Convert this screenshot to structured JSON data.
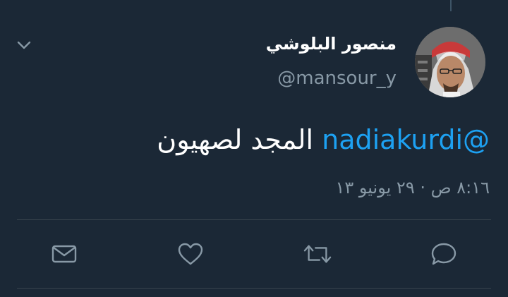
{
  "tweet": {
    "display_name": "منصور البلوشي",
    "handle": "@mansour_y",
    "mention": "@nadiakurdi",
    "body": "المجد لصهيون",
    "timestamp": "٨:١٦ ص · ٢٩ يونيو ١٣"
  },
  "icons": {
    "caret": "chevron-down-icon",
    "reply": "reply-icon",
    "retweet": "retweet-icon",
    "like": "heart-icon",
    "message": "envelope-icon"
  },
  "colors": {
    "background": "#1b2836",
    "text": "#ffffff",
    "secondary": "#8899a6",
    "mention": "#1da1f2",
    "divider": "#38444d"
  }
}
